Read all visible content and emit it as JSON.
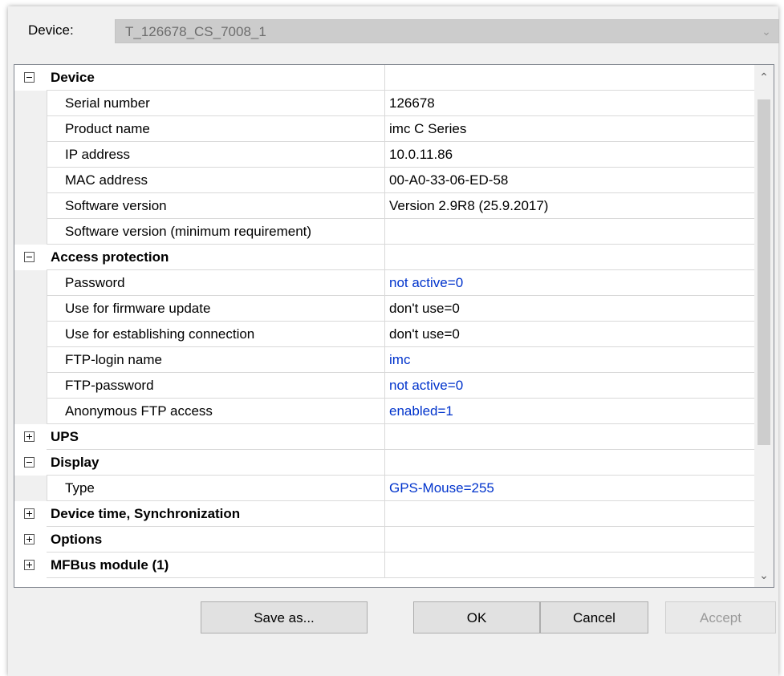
{
  "device": {
    "label": "Device:",
    "value": "T_126678_CS_7008_1"
  },
  "rows": [
    {
      "type": "cat",
      "expanded": true,
      "name": "Device",
      "value": ""
    },
    {
      "type": "item",
      "name": "Serial number",
      "value": "126678",
      "link": false
    },
    {
      "type": "item",
      "name": "Product name",
      "value": "imc C Series",
      "link": false
    },
    {
      "type": "item",
      "name": "IP address",
      "value": "10.0.11.86",
      "link": false
    },
    {
      "type": "item",
      "name": "MAC address",
      "value": "00-A0-33-06-ED-58",
      "link": false
    },
    {
      "type": "item",
      "name": "Software version",
      "value": "Version 2.9R8 (25.9.2017)",
      "link": false
    },
    {
      "type": "item",
      "name": "Software version (minimum requirement)",
      "value": "",
      "link": false
    },
    {
      "type": "cat",
      "expanded": true,
      "name": "Access protection",
      "value": ""
    },
    {
      "type": "item",
      "name": "Password",
      "value": "not active=0",
      "link": true
    },
    {
      "type": "item",
      "name": "Use for firmware update",
      "value": "don't use=0",
      "link": false
    },
    {
      "type": "item",
      "name": "Use for establishing connection",
      "value": "don't use=0",
      "link": false
    },
    {
      "type": "item",
      "name": "FTP-login name",
      "value": "imc",
      "link": true
    },
    {
      "type": "item",
      "name": "FTP-password",
      "value": "not active=0",
      "link": true
    },
    {
      "type": "item",
      "name": "Anonymous FTP access",
      "value": "enabled=1",
      "link": true
    },
    {
      "type": "cat",
      "expanded": false,
      "name": "UPS",
      "value": ""
    },
    {
      "type": "cat",
      "expanded": true,
      "name": "Display",
      "value": ""
    },
    {
      "type": "item",
      "name": "Type",
      "value": "GPS-Mouse=255",
      "link": true
    },
    {
      "type": "cat",
      "expanded": false,
      "name": "Device time, Synchronization",
      "value": ""
    },
    {
      "type": "cat",
      "expanded": false,
      "name": "Options",
      "value": ""
    },
    {
      "type": "cat",
      "expanded": false,
      "name": "MFBus module (1)",
      "value": ""
    }
  ],
  "buttons": {
    "save_as": "Save as...",
    "ok": "OK",
    "cancel": "Cancel",
    "accept": "Accept"
  },
  "scroll_position_fraction": 0.0,
  "icons": {
    "collapse": "minus-box-icon",
    "expand": "plus-box-icon",
    "scroll_up": "chevron-up-icon",
    "scroll_down": "chevron-down-icon",
    "combo": "chevron-down-icon"
  },
  "colors": {
    "link": "#0033cc",
    "disabled_text": "#9a9a9a"
  }
}
